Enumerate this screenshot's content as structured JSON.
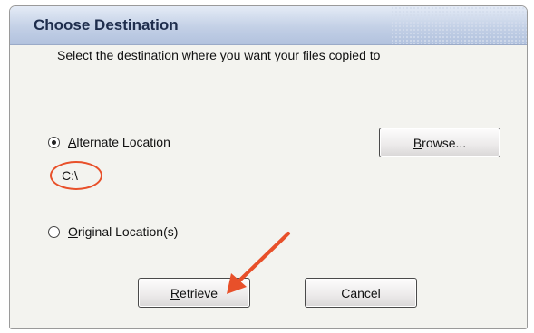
{
  "dialog": {
    "title": "Choose Destination",
    "instruction": "Select the destination where you want your files copied to",
    "options": {
      "alternate": {
        "mnemonic": "A",
        "rest": "lternate Location",
        "selected": true
      },
      "original": {
        "mnemonic": "O",
        "rest": "riginal Location(s)",
        "selected": false
      }
    },
    "path_value": "C:\\",
    "browse": {
      "mnemonic": "B",
      "rest": "rowse..."
    },
    "retrieve": {
      "mnemonic": "R",
      "rest": "etrieve"
    },
    "cancel_label": "Cancel"
  },
  "annotation": {
    "color": "#e8502a"
  }
}
